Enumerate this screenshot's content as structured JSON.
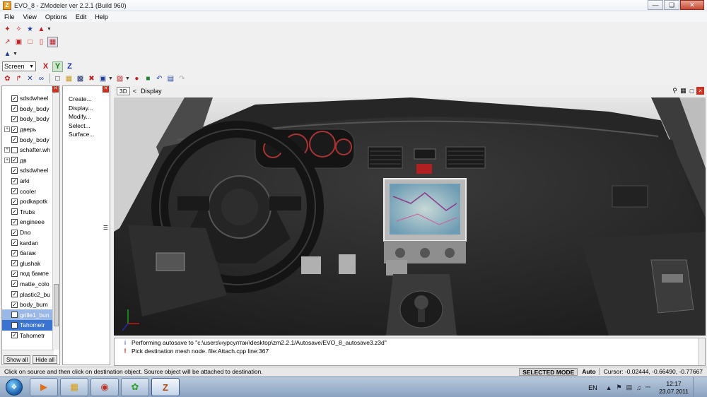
{
  "window": {
    "title": "EVO_8 - ZModeler ver 2.2.1 (Build 960)",
    "app_icon_glyph": "Z"
  },
  "menus": [
    "File",
    "View",
    "Options",
    "Edit",
    "Help"
  ],
  "toolbar": {
    "view_combo": "Screen",
    "axis_x": "X",
    "axis_y": "Y",
    "axis_z": "Z"
  },
  "scene_tree": {
    "items": [
      {
        "label": "sdsdwheel",
        "expander": "",
        "checked": true
      },
      {
        "label": "body_body",
        "expander": "",
        "checked": true
      },
      {
        "label": "body_body",
        "expander": "",
        "checked": true
      },
      {
        "label": "дверь",
        "expander": "+",
        "checked": true
      },
      {
        "label": "body_body",
        "expander": "",
        "checked": true
      },
      {
        "label": "schafter.wh",
        "expander": "+",
        "checked": false
      },
      {
        "label": "дв",
        "expander": "+",
        "checked": true
      },
      {
        "label": "sdsdwheel",
        "expander": "",
        "checked": true
      },
      {
        "label": "arki",
        "expander": "",
        "checked": true
      },
      {
        "label": "cooler",
        "expander": "",
        "checked": true
      },
      {
        "label": "podkapotk",
        "expander": "",
        "checked": true
      },
      {
        "label": "Trubs",
        "expander": "",
        "checked": true
      },
      {
        "label": "engineee",
        "expander": "",
        "checked": true
      },
      {
        "label": "Dno",
        "expander": "",
        "checked": true
      },
      {
        "label": "kardan",
        "expander": "",
        "checked": true
      },
      {
        "label": "багаж",
        "expander": "",
        "checked": true
      },
      {
        "label": "glushak",
        "expander": "",
        "checked": true
      },
      {
        "label": "под бампе",
        "expander": "",
        "checked": true
      },
      {
        "label": "matte_colo",
        "expander": "",
        "checked": true
      },
      {
        "label": "plastic2_bu",
        "expander": "",
        "checked": true
      },
      {
        "label": "body_bum",
        "expander": "",
        "checked": true
      },
      {
        "label": "grille1_bun",
        "expander": "",
        "checked": true,
        "state": "sel2"
      },
      {
        "label": "Tahometr",
        "expander": "",
        "checked": false,
        "state": "sel"
      },
      {
        "label": "Tahometr",
        "expander": "",
        "checked": true
      }
    ],
    "show_all": "Show all",
    "hide_all": "Hide all"
  },
  "command_panel": {
    "items": [
      "Create...",
      "Display...",
      "Modify...",
      "Select...",
      "Surface..."
    ]
  },
  "viewport": {
    "mode_button": "3D",
    "back_glyph": "<",
    "crumb": "Display"
  },
  "log": {
    "entries": [
      {
        "icon": "i",
        "kind": "info",
        "text": "Performing autosave to \"c:\\users\\нурсултан\\desktop\\zm2.2.1/Autosave/EVO_8_autosave3.z3d\""
      },
      {
        "icon": "!",
        "kind": "err",
        "text": "Pick destination mesh node. file:Attach.cpp line:367"
      }
    ]
  },
  "status": {
    "message": "Click on source and then click on destination object. Source object will be attached to destination.",
    "mode": "SELECTED MODE",
    "auto": "Auto",
    "cursor": "Cursor: -0.02444, -0.66490, -0.77667"
  },
  "taskbar": {
    "lang": "EN",
    "time": "12:17",
    "date": "23.07.2011"
  },
  "colors": {
    "selection": "#3a74d0",
    "close_red": "#c83020",
    "axis_x": "#c01818",
    "axis_y": "#18801a",
    "axis_z": "#1830b0"
  }
}
